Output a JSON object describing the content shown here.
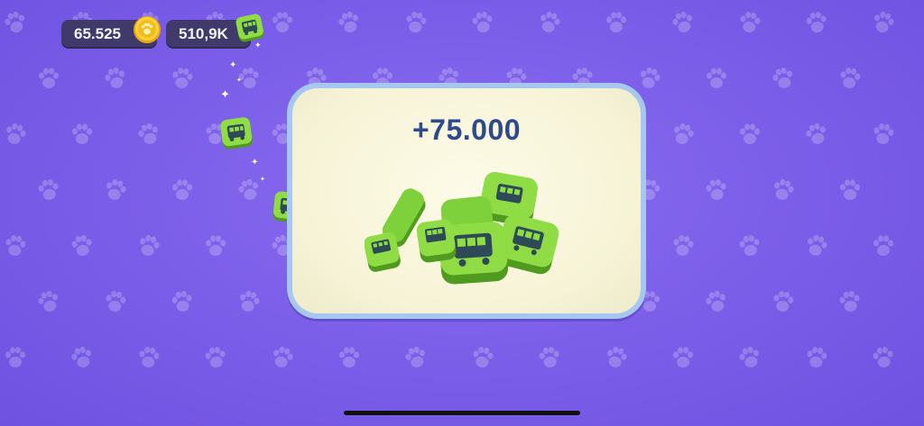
{
  "hud": {
    "coins": "65.525",
    "tokens": "510,9K",
    "coin_icon": "gold-paw-coin-icon",
    "token_icon": "green-bus-token-icon"
  },
  "reward": {
    "amount": "+75.000",
    "icon": "green-bus-token-pile"
  },
  "colors": {
    "background": "#7a5de8",
    "card_border": "#a6c8f0",
    "card_fill": "#f6f3d6",
    "reward_text": "#2f4a8c",
    "token_green": "#7fd13b",
    "hud_pill": "#3f3a6a"
  }
}
